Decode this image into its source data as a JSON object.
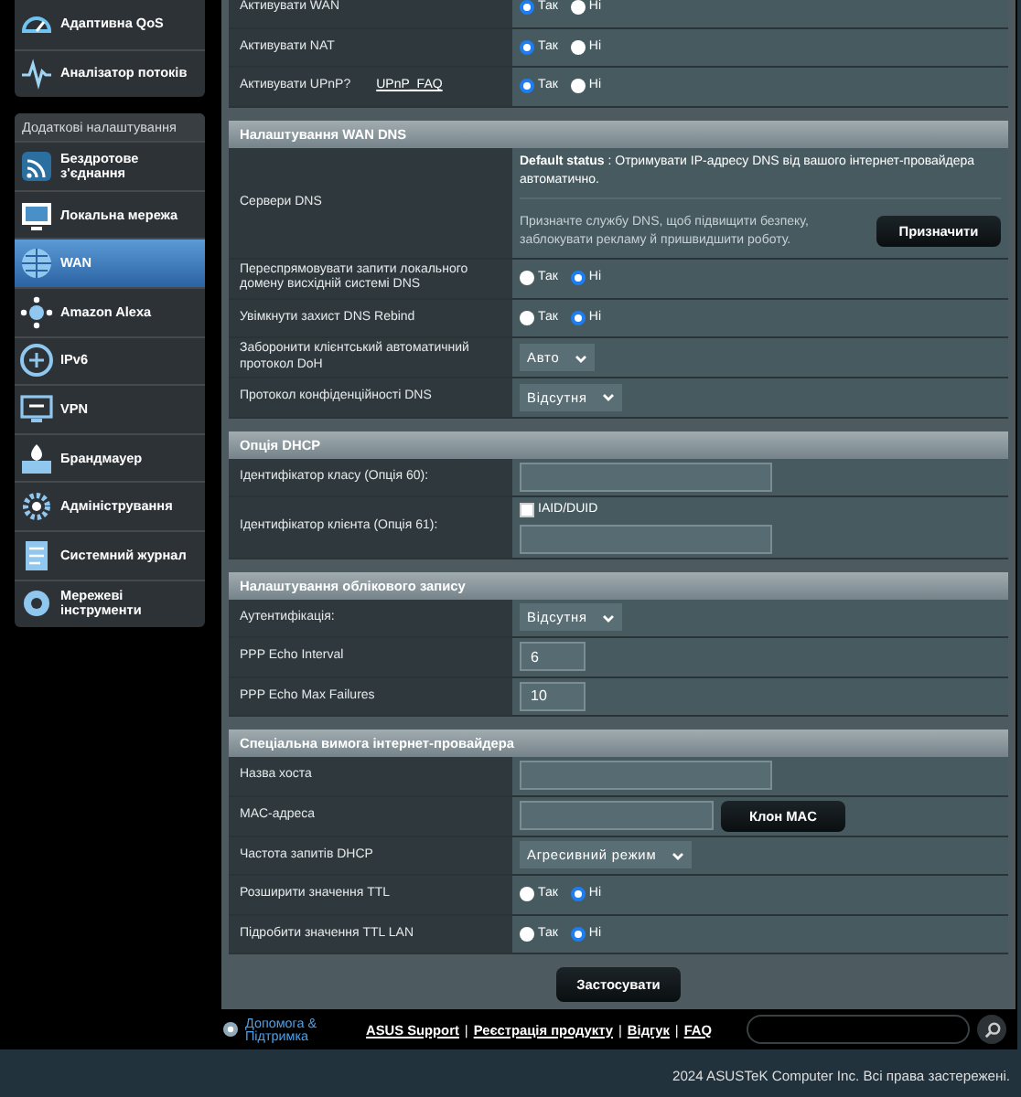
{
  "sidebar": {
    "top_items": [
      {
        "label": "Адаптивна QoS",
        "selected": false
      },
      {
        "label": "Аналізатор потоків",
        "selected": false
      }
    ],
    "section_title": "Додаткові налаштування",
    "items": [
      {
        "label": "Бездротове з'єднання",
        "selected": false
      },
      {
        "label": "Локальна мережа",
        "selected": false
      },
      {
        "label": "WAN",
        "selected": true
      },
      {
        "label": "Amazon Alexa",
        "selected": false
      },
      {
        "label": "IPv6",
        "selected": false
      },
      {
        "label": "VPN",
        "selected": false
      },
      {
        "label": "Брандмауер",
        "selected": false
      },
      {
        "label": "Адміністрування",
        "selected": false
      },
      {
        "label": "Системний журнал",
        "selected": false
      },
      {
        "label": "Мережеві інструменти",
        "selected": false
      }
    ]
  },
  "sections": [
    {
      "rows": [
        {
          "label": "Активувати WAN",
          "kind": "radio",
          "options": [
            {
              "label": "Так",
              "selected": true
            },
            {
              "label": "Ні",
              "selected": false
            }
          ]
        },
        {
          "label": "Активувати NAT",
          "kind": "radio",
          "options": [
            {
              "label": "Так",
              "selected": true
            },
            {
              "label": "Ні",
              "selected": false
            }
          ]
        },
        {
          "label": "Активувати UPnP?",
          "link": "UPnP_FAQ",
          "kind": "radio",
          "options": [
            {
              "label": "Так",
              "selected": true
            },
            {
              "label": "Ні",
              "selected": false
            }
          ]
        }
      ]
    },
    {
      "title": "Налаштування WAN DNS",
      "rows": [
        {
          "label": "Сервери DNS",
          "kind": "dns",
          "status": "**Default status** : Отримувати IP-адресу DNS від вашого інтернет-провайдера автоматично.",
          "hint": "Призначте службу DNS, щоб підвищити безпеку, заблокувати рекламу й пришвидшити роботу.",
          "button": "Призначити"
        },
        {
          "label": "Переспрямовувати запити локального домену висхідній системі DNS",
          "kind": "radio",
          "options": [
            {
              "label": "Так",
              "selected": false
            },
            {
              "label": "Ні",
              "selected": true
            }
          ]
        },
        {
          "label": "Увімкнути захист DNS Rebind",
          "kind": "radio",
          "options": [
            {
              "label": "Так",
              "selected": false
            },
            {
              "label": "Ні",
              "selected": true
            }
          ]
        },
        {
          "label": "Заборонити клієнтський автоматичний протокол DoH",
          "kind": "select",
          "value": "Авто"
        },
        {
          "label": "Протокол конфіденційності DNS",
          "kind": "select",
          "value": "Відсутня"
        }
      ]
    },
    {
      "title": "Опція DHCP",
      "rows": [
        {
          "label": "Ідентифікатор класу (Опція 60):",
          "kind": "input",
          "value": ""
        },
        {
          "label": "Ідентифікатор клієнта (Опція 61):",
          "kind": "checkinput",
          "check_label": "IAID/DUID",
          "checked": false
        }
      ]
    },
    {
      "title": "Налаштування облікового запису",
      "rows": [
        {
          "label": "Аутентифікація:",
          "kind": "select",
          "value": "Відсутня"
        },
        {
          "label": "PPP Echo Interval",
          "kind": "input",
          "value": "6"
        },
        {
          "label": "PPP Echo Max Failures",
          "kind": "input",
          "value": "10"
        }
      ]
    },
    {
      "title": "Спеціальна вимога інтернет-провайдера",
      "rows": [
        {
          "label": "Назва хоста",
          "kind": "input",
          "value": ""
        },
        {
          "label": "MAC-адреса",
          "kind": "inputbutton",
          "value": "",
          "button": "Клон MAC"
        },
        {
          "label": "Частота запитів DHCP",
          "kind": "select",
          "value": "Агресивний режим"
        },
        {
          "label": "Розширити значення TTL",
          "kind": "radio",
          "options": [
            {
              "label": "Так",
              "selected": false
            },
            {
              "label": "Ні",
              "selected": true
            }
          ]
        },
        {
          "label": "Підробити значення TTL LAN",
          "kind": "radio",
          "options": [
            {
              "label": "Так",
              "selected": false
            },
            {
              "label": "Ні",
              "selected": true
            }
          ]
        }
      ]
    }
  ],
  "apply_button": "Застосувати",
  "footer": {
    "help": "Допомога & Підтримка",
    "links": [
      "ASUS Support",
      "Реєстрація продукту",
      "Відгук",
      "FAQ"
    ],
    "separator": "|"
  },
  "copyright": "2024 ASUSTeK Computer Inc. Всі права застережені."
}
